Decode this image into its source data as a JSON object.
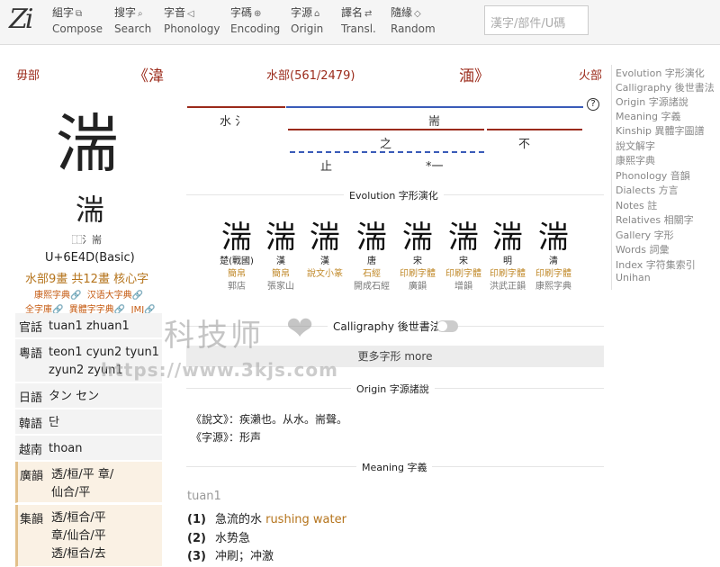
{
  "nav": {
    "logo": "Zi",
    "items": [
      {
        "zh": "組字",
        "en": "Compose",
        "icon": "⧉"
      },
      {
        "zh": "搜字",
        "en": "Search",
        "icon": "⌕"
      },
      {
        "zh": "字音",
        "en": "Phonology",
        "icon": "◁"
      },
      {
        "zh": "字碼",
        "en": "Encoding",
        "icon": "⊕"
      },
      {
        "zh": "字源",
        "en": "Origin",
        "icon": "⌂"
      },
      {
        "zh": "譯名",
        "en": "Transl.",
        "icon": "⇄"
      },
      {
        "zh": "隨緣",
        "en": "Random",
        "icon": "◇"
      }
    ],
    "search_placeholder": "漢字/部件/U碼"
  },
  "header": {
    "prev_radical": "毋部",
    "prev_char": "《湋",
    "radical_pos": "水部(561/2479)",
    "next_char": "湎》",
    "next_radical": "火部"
  },
  "char": {
    "glyph": "湍",
    "seal": "湍",
    "components": "⿰氵耑",
    "unicode": "U+6E4D(Basic)",
    "strokes": "水部9畫 共12畫 核心字",
    "links1": [
      "康熙字典🔗",
      "汉语大字典🔗"
    ],
    "links2": [
      "全字庫🔗",
      "異體字字典🔗",
      "JMJ🔗"
    ]
  },
  "pronunciations": [
    {
      "label": "官話",
      "value": "tuan1 zhuan1"
    },
    {
      "label": "粵語",
      "value": "teon1 cyun2 tyun1 zyun2 zyun1"
    },
    {
      "label": "日語",
      "value": "タン セン"
    },
    {
      "label": "韓語",
      "value": "단"
    },
    {
      "label": "越南",
      "value": "thoan"
    },
    {
      "label": "廣韻",
      "value": "透/桓/平 章/仙合/平"
    },
    {
      "label": "集韻",
      "value": "透/桓合/平 章/仙合/平 透/桓合/去"
    }
  ],
  "decomp": {
    "shui": "水 氵",
    "duan": "耑",
    "zhi_top": "之",
    "bu": "不",
    "zhi_foot": "止",
    "yi": "*一",
    "help": "?"
  },
  "evolution": {
    "title": "Evolution 字形演化",
    "items": [
      {
        "glyph": "湍",
        "dyn": "楚(戰國)",
        "style": "簡帛",
        "src": "郭店"
      },
      {
        "glyph": "湍",
        "dyn": "漢",
        "style": "簡帛",
        "src": "張家山"
      },
      {
        "glyph": "湍",
        "dyn": "漢",
        "style": "說文小篆",
        "src": ""
      },
      {
        "glyph": "湍",
        "dyn": "唐",
        "style": "石經",
        "src": "開成石經"
      },
      {
        "glyph": "湍",
        "dyn": "宋",
        "style": "印刷字體",
        "src": "廣韻"
      },
      {
        "glyph": "湍",
        "dyn": "宋",
        "style": "印刷字體",
        "src": "增韻"
      },
      {
        "glyph": "湍",
        "dyn": "明",
        "style": "印刷字體",
        "src": "洪武正韻"
      },
      {
        "glyph": "湍",
        "dyn": "清",
        "style": "印刷字體",
        "src": "康熙字典"
      }
    ]
  },
  "calligraphy_title": "Calligraphy 後世書法",
  "more_button": "更多字形 more",
  "origin": {
    "title": "Origin 字源諸說",
    "lines": [
      "《說文》：疾瀨也。从水。耑聲。",
      "《字源》：形声"
    ]
  },
  "meaning": {
    "title": "Meaning 字義",
    "pinyin": "tuan1",
    "items": [
      {
        "num": "(1)",
        "zh": "急流的水",
        "en": "rushing water"
      },
      {
        "num": "(2)",
        "zh": "水势急",
        "en": ""
      },
      {
        "num": "(3)",
        "zh": "冲刷；冲激",
        "en": ""
      }
    ]
  },
  "sidebar": [
    "Evolution 字形演化",
    "Calligraphy 後世書法",
    "Origin 字源諸說",
    "Meaning 字義",
    "Kinship 異體字圖譜",
    "說文解字",
    "康熙字典",
    "Phonology 音韻",
    "Dialects 方言",
    "Notes 註",
    "Relatives 相關字",
    "Gallery 字形",
    "Words 詞彙",
    "Index 字符集索引",
    "Unihan"
  ],
  "watermark": {
    "line1": "科技师",
    "heart": "❤",
    "line2": "https://www.3kjs.com"
  }
}
